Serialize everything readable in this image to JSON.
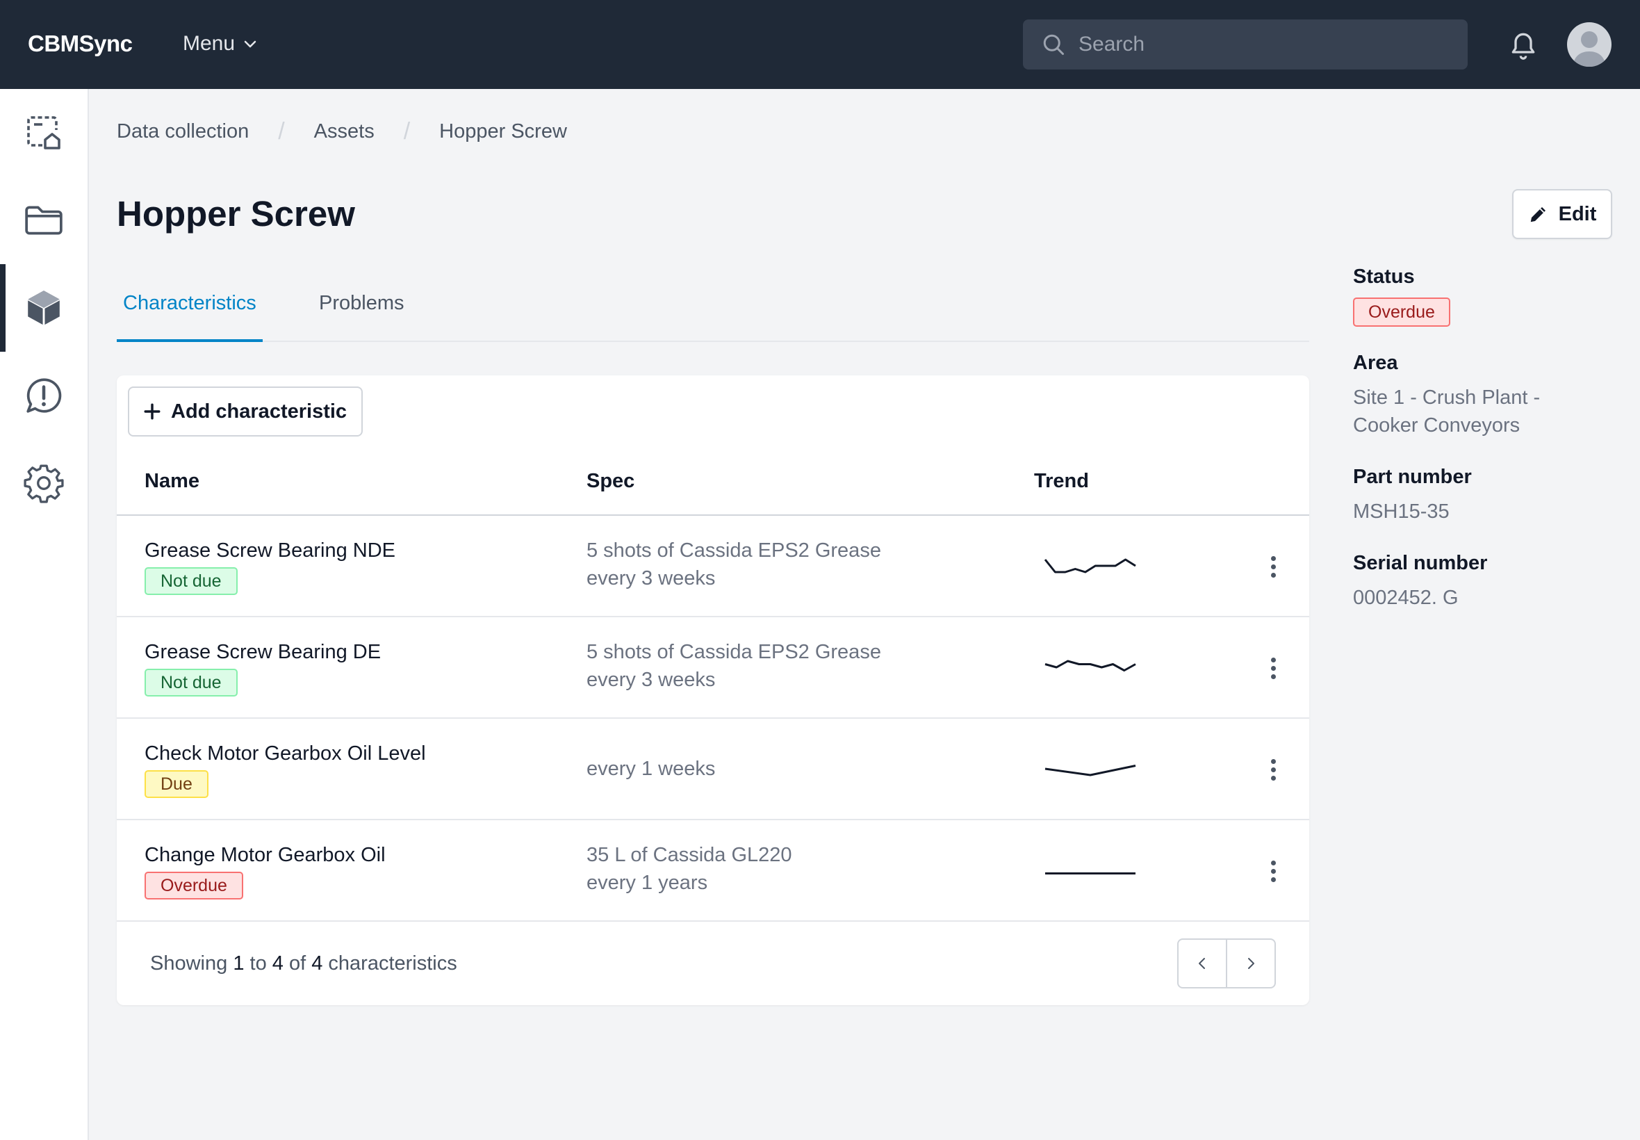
{
  "app": {
    "name": "CBMSync",
    "menu_label": "Menu"
  },
  "search": {
    "placeholder": "Search"
  },
  "sidebar": {
    "items": [
      {
        "icon": "dashboard-icon",
        "active": false
      },
      {
        "icon": "folder-icon",
        "active": false
      },
      {
        "icon": "cube-icon",
        "active": true
      },
      {
        "icon": "alert-message-icon",
        "active": false
      },
      {
        "icon": "gear-icon",
        "active": false
      }
    ]
  },
  "breadcrumb": [
    "Data collection",
    "Assets",
    "Hopper Screw"
  ],
  "page": {
    "title": "Hopper Screw",
    "edit_label": "Edit"
  },
  "tabs": [
    {
      "label": "Characteristics",
      "active": true
    },
    {
      "label": "Problems",
      "active": false
    }
  ],
  "table": {
    "add_label": "Add characteristic",
    "headers": [
      "Name",
      "Spec",
      "Trend"
    ],
    "rows": [
      {
        "name": "Grease Screw Bearing NDE",
        "status": "Not due",
        "status_color": "green",
        "spec_line1": "5 shots of Cassida EPS2 Grease",
        "spec_line2": "every 3 weeks",
        "trend": [
          6,
          2,
          2,
          3,
          2,
          4,
          4,
          4,
          6,
          4
        ]
      },
      {
        "name": "Grease Screw Bearing DE",
        "status": "Not due",
        "status_color": "green",
        "spec_line1": "5 shots of Cassida EPS2 Grease",
        "spec_line2": "every 3 weeks",
        "trend": [
          5,
          4,
          6,
          5,
          5,
          4,
          5,
          3,
          5
        ]
      },
      {
        "name": "Check Motor Gearbox Oil Level",
        "status": "Due",
        "status_color": "yellow",
        "spec_line1": "every 1 weeks",
        "spec_line2": "",
        "trend": [
          4,
          2,
          5
        ]
      },
      {
        "name": "Change Motor Gearbox Oil",
        "status": "Overdue",
        "status_color": "red",
        "spec_line1": "35 L of Cassida GL220",
        "spec_line2": "every 1 years",
        "trend": [
          3,
          3
        ]
      }
    ],
    "footer": {
      "showing": "Showing",
      "from": "1",
      "to_word": "to",
      "to": "4",
      "of_word": "of",
      "total": "4",
      "suffix": "characteristics"
    }
  },
  "details": {
    "status_label": "Status",
    "status_value": "Overdue",
    "area_label": "Area",
    "area_line1": "Site 1 - Crush Plant -",
    "area_line2": "Cooker Conveyors",
    "part_label": "Part number",
    "part_value": "MSH15-35",
    "serial_label": "Serial number",
    "serial_value": "0002452. G"
  },
  "colors": {
    "topbar": "#1f2937",
    "accent": "#0284c7",
    "overdue": "#991b1b",
    "not_due": "#166534",
    "due": "#713f12"
  }
}
